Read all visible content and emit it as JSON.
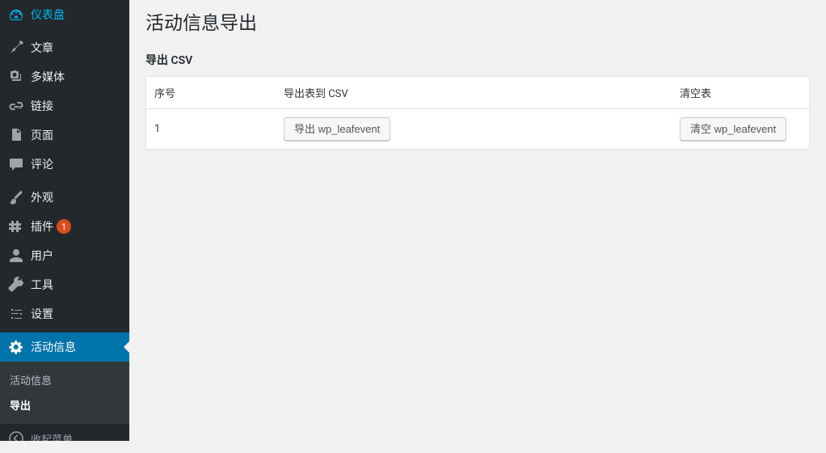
{
  "sidebar": {
    "items": [
      {
        "label": "仪表盘"
      },
      {
        "label": "文章"
      },
      {
        "label": "多媒体"
      },
      {
        "label": "链接"
      },
      {
        "label": "页面"
      },
      {
        "label": "评论"
      },
      {
        "label": "外观"
      },
      {
        "label": "插件",
        "badge": "1"
      },
      {
        "label": "用户"
      },
      {
        "label": "工具"
      },
      {
        "label": "设置"
      },
      {
        "label": "活动信息"
      }
    ],
    "submenu": [
      {
        "label": "活动信息"
      },
      {
        "label": "导出"
      }
    ],
    "collapse_label": "收起菜单"
  },
  "page": {
    "title": "活动信息导出",
    "section_title": "导出 CSV"
  },
  "table": {
    "headers": {
      "seq": "序号",
      "export": "导出表到 CSV",
      "clear": "清空表"
    },
    "rows": [
      {
        "seq": "1",
        "export_btn": "导出 wp_leafevent",
        "clear_btn": "清空 wp_leafevent"
      }
    ]
  }
}
